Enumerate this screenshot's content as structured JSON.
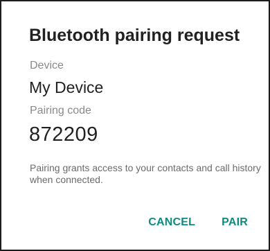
{
  "dialog": {
    "title": "Bluetooth pairing request",
    "device_label": "Device",
    "device_name": "My Device",
    "code_label": "Pairing code",
    "pairing_code": "872209",
    "note": "Pairing grants access to your contacts and call history when connected.",
    "cancel_label": "CANCEL",
    "pair_label": "PAIR"
  },
  "colors": {
    "accent": "#0f8a80",
    "title_text": "#212121",
    "secondary_text": "#8a8a8a",
    "border": "#1c1c1c"
  }
}
